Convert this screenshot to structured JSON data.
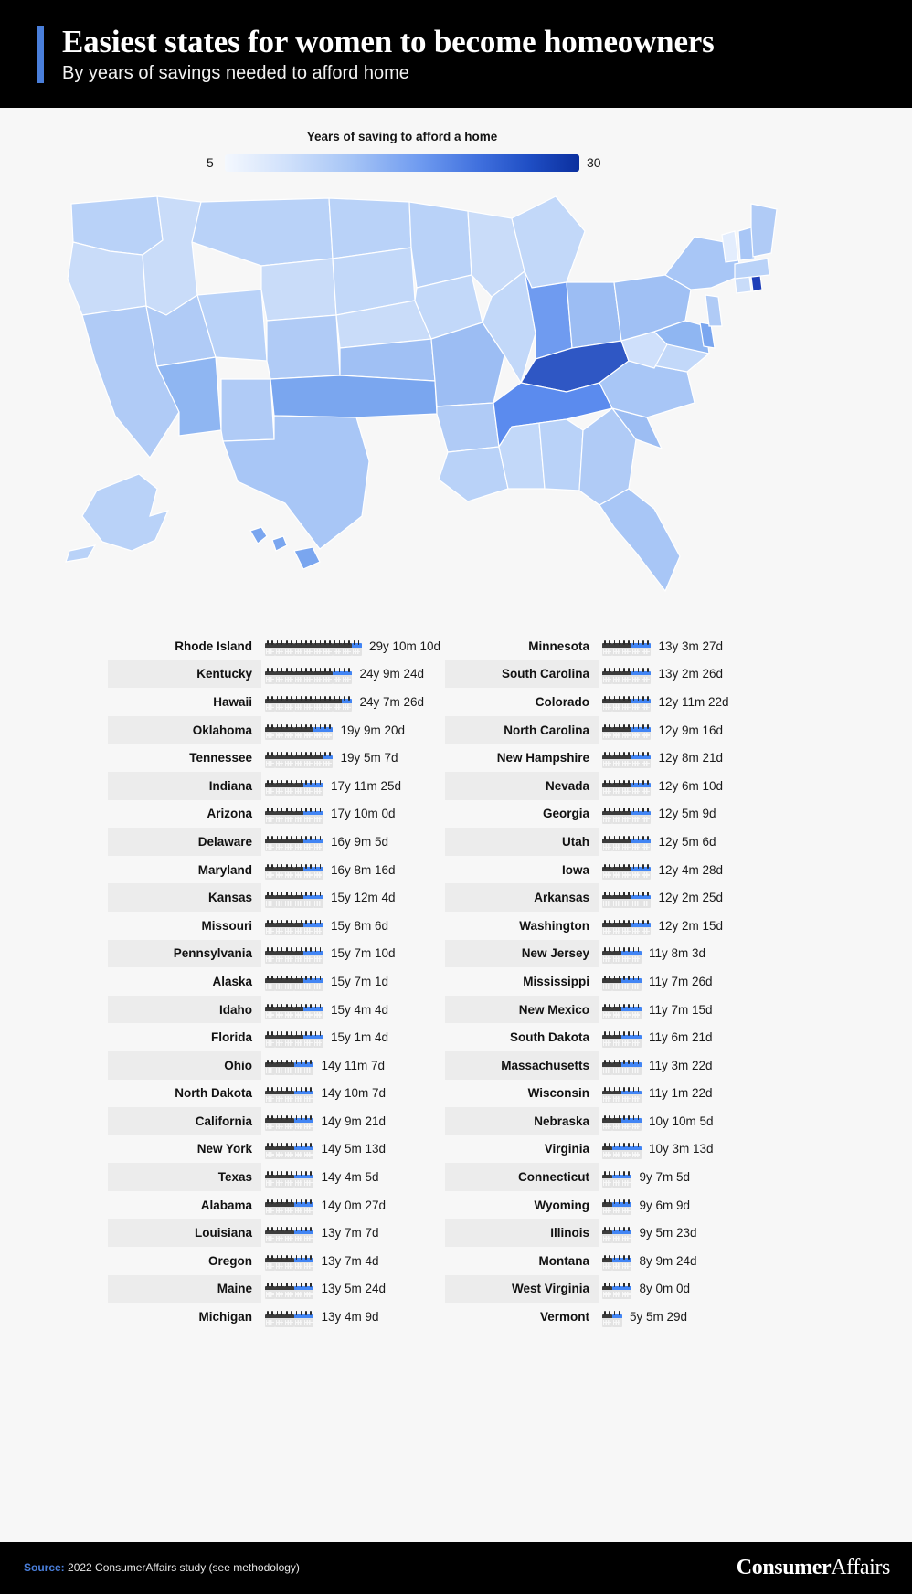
{
  "header": {
    "title": "Easiest states for women to become homeowners",
    "subtitle": "By years of savings needed to afford home",
    "accent_color": "#4a7fdb",
    "background_color": "#000000"
  },
  "legend": {
    "title": "Years of saving to afford a home",
    "min_label": "5",
    "max_label": "30",
    "gradient_low_color": "#f4f8fe",
    "gradient_high_color": "#0b2f9e"
  },
  "footer": {
    "source_prefix": "Source:",
    "source_text": " 2022 ConsumerAffairs study (see methodology)",
    "logo_bold": "Consumer",
    "logo_light": "Affairs"
  },
  "chart_data": {
    "type": "map",
    "title": "Easiest states for women to become homeowners",
    "subtitle": "By years of savings needed to afford home",
    "unit": "years of saving to afford a home",
    "value_range": [
      5,
      30
    ],
    "legend_position": "top",
    "columns": {
      "left": [
        {
          "state": "Rhode Island",
          "value_text": "29y 10m 10d",
          "years": 29.86,
          "calendars": 10,
          "blue": 1
        },
        {
          "state": "Kentucky",
          "value_text": "24y 9m 24d",
          "years": 24.82,
          "calendars": 9,
          "blue": 2
        },
        {
          "state": "Hawaii",
          "value_text": "24y 7m 26d",
          "years": 24.66,
          "calendars": 9,
          "blue": 1
        },
        {
          "state": "Oklahoma",
          "value_text": "19y 9m 20d",
          "years": 19.8,
          "calendars": 7,
          "blue": 2
        },
        {
          "state": "Tennessee",
          "value_text": "19y 5m 7d",
          "years": 19.44,
          "calendars": 7,
          "blue": 1
        },
        {
          "state": "Indiana",
          "value_text": "17y 11m 25d",
          "years": 17.99,
          "calendars": 6,
          "blue": 2
        },
        {
          "state": "Arizona",
          "value_text": "17y 10m 0d",
          "years": 17.83,
          "calendars": 6,
          "blue": 2
        },
        {
          "state": "Delaware",
          "value_text": "16y 9m 5d",
          "years": 16.76,
          "calendars": 6,
          "blue": 2
        },
        {
          "state": "Maryland",
          "value_text": "16y 8m 16d",
          "years": 16.71,
          "calendars": 6,
          "blue": 2
        },
        {
          "state": "Kansas",
          "value_text": "15y 12m 4d",
          "years": 16.01,
          "calendars": 6,
          "blue": 2
        },
        {
          "state": "Missouri",
          "value_text": "15y 8m 6d",
          "years": 15.68,
          "calendars": 6,
          "blue": 2
        },
        {
          "state": "Pennsylvania",
          "value_text": "15y 7m 10d",
          "years": 15.61,
          "calendars": 6,
          "blue": 2
        },
        {
          "state": "Alaska",
          "value_text": "15y 7m 1d",
          "years": 15.58,
          "calendars": 6,
          "blue": 2
        },
        {
          "state": "Idaho",
          "value_text": "15y 4m 4d",
          "years": 15.34,
          "calendars": 6,
          "blue": 2
        },
        {
          "state": "Florida",
          "value_text": "15y 1m 4d",
          "years": 15.09,
          "calendars": 6,
          "blue": 2
        },
        {
          "state": "Ohio",
          "value_text": "14y 11m 7d",
          "years": 14.93,
          "calendars": 5,
          "blue": 2
        },
        {
          "state": "North Dakota",
          "value_text": "14y 10m 7d",
          "years": 14.85,
          "calendars": 5,
          "blue": 2
        },
        {
          "state": "California",
          "value_text": "14y 9m 21d",
          "years": 14.81,
          "calendars": 5,
          "blue": 2
        },
        {
          "state": "New York",
          "value_text": "14y 5m 13d",
          "years": 14.45,
          "calendars": 5,
          "blue": 2
        },
        {
          "state": "Texas",
          "value_text": "14y 4m 5d",
          "years": 14.35,
          "calendars": 5,
          "blue": 2
        },
        {
          "state": "Alabama",
          "value_text": "14y 0m 27d",
          "years": 14.07,
          "calendars": 5,
          "blue": 2
        },
        {
          "state": "Louisiana",
          "value_text": "13y 7m 7d",
          "years": 13.6,
          "calendars": 5,
          "blue": 2
        },
        {
          "state": "Oregon",
          "value_text": "13y 7m 4d",
          "years": 13.59,
          "calendars": 5,
          "blue": 2
        },
        {
          "state": "Maine",
          "value_text": "13y 5m 24d",
          "years": 13.48,
          "calendars": 5,
          "blue": 2
        },
        {
          "state": "Michigan",
          "value_text": "13y 4m 9d",
          "years": 13.36,
          "calendars": 5,
          "blue": 2
        }
      ],
      "right": [
        {
          "state": "Minnesota",
          "value_text": "13y 3m 27d",
          "years": 13.32,
          "calendars": 5,
          "blue": 2
        },
        {
          "state": "South Carolina",
          "value_text": "13y 2m 26d",
          "years": 13.24,
          "calendars": 5,
          "blue": 2
        },
        {
          "state": "Colorado",
          "value_text": "12y 11m 22d",
          "years": 12.98,
          "calendars": 5,
          "blue": 2
        },
        {
          "state": "North Carolina",
          "value_text": "12y 9m 16d",
          "years": 12.79,
          "calendars": 5,
          "blue": 2
        },
        {
          "state": "New Hampshire",
          "value_text": "12y 8m 21d",
          "years": 12.72,
          "calendars": 5,
          "blue": 2
        },
        {
          "state": "Nevada",
          "value_text": "12y 6m 10d",
          "years": 12.53,
          "calendars": 5,
          "blue": 2
        },
        {
          "state": "Georgia",
          "value_text": "12y 5m 9d",
          "years": 12.44,
          "calendars": 5,
          "blue": 2
        },
        {
          "state": "Utah",
          "value_text": "12y 5m 6d",
          "years": 12.43,
          "calendars": 5,
          "blue": 2
        },
        {
          "state": "Iowa",
          "value_text": "12y 4m 28d",
          "years": 12.41,
          "calendars": 5,
          "blue": 2
        },
        {
          "state": "Arkansas",
          "value_text": "12y 2m 25d",
          "years": 12.24,
          "calendars": 5,
          "blue": 2
        },
        {
          "state": "Washington",
          "value_text": "12y 2m 15d",
          "years": 12.21,
          "calendars": 5,
          "blue": 2
        },
        {
          "state": "New Jersey",
          "value_text": "11y 8m 3d",
          "years": 11.67,
          "calendars": 4,
          "blue": 2
        },
        {
          "state": "Mississippi",
          "value_text": "11y 7m 26d",
          "years": 11.65,
          "calendars": 4,
          "blue": 2
        },
        {
          "state": "New Mexico",
          "value_text": "11y 7m 15d",
          "years": 11.62,
          "calendars": 4,
          "blue": 2
        },
        {
          "state": "South Dakota",
          "value_text": "11y 6m 21d",
          "years": 11.56,
          "calendars": 4,
          "blue": 2
        },
        {
          "state": "Massachusetts",
          "value_text": "11y 3m 22d",
          "years": 11.31,
          "calendars": 4,
          "blue": 2
        },
        {
          "state": "Wisconsin",
          "value_text": "11y 1m 22d",
          "years": 11.14,
          "calendars": 4,
          "blue": 2
        },
        {
          "state": "Nebraska",
          "value_text": "10y 10m 5d",
          "years": 10.85,
          "calendars": 4,
          "blue": 2
        },
        {
          "state": "Virginia",
          "value_text": "10y 3m 13d",
          "years": 10.29,
          "calendars": 4,
          "blue": 3
        },
        {
          "state": "Connecticut",
          "value_text": "9y 7m 5d",
          "years": 9.6,
          "calendars": 3,
          "blue": 2
        },
        {
          "state": "Wyoming",
          "value_text": "9y 6m 9d",
          "years": 9.52,
          "calendars": 3,
          "blue": 2
        },
        {
          "state": "Illinois",
          "value_text": "9y 5m 23d",
          "years": 9.48,
          "calendars": 3,
          "blue": 2
        },
        {
          "state": "Montana",
          "value_text": "8y 9m 24d",
          "years": 8.82,
          "calendars": 3,
          "blue": 2
        },
        {
          "state": "West Virginia",
          "value_text": "8y 0m 0d",
          "years": 8.0,
          "calendars": 3,
          "blue": 2
        },
        {
          "state": "Vermont",
          "value_text": "5y 5m 29d",
          "years": 5.49,
          "calendars": 2,
          "blue": 1
        }
      ]
    }
  }
}
